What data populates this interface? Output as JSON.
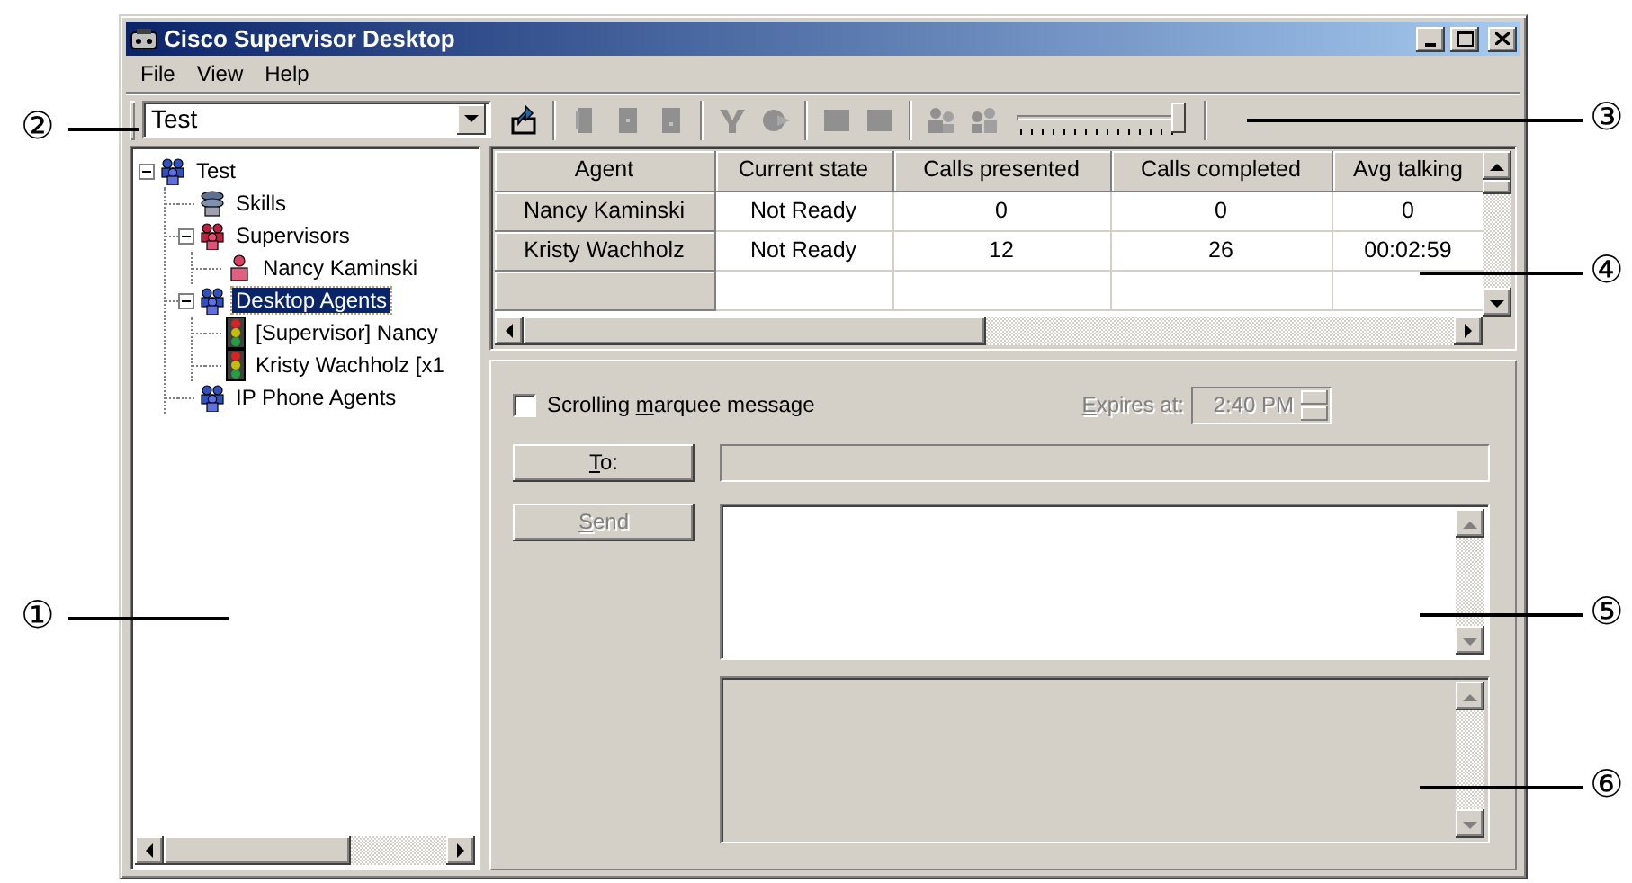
{
  "window": {
    "title": "Cisco Supervisor Desktop"
  },
  "menu": [
    {
      "label": "File"
    },
    {
      "label": "View"
    },
    {
      "label": "Help"
    }
  ],
  "team_select": {
    "value": "Test"
  },
  "toolbar": {
    "slider": {
      "level": 1.0
    }
  },
  "tree": [
    {
      "label": "Test",
      "kind": "agent-group",
      "expanded": true,
      "selected": false,
      "children": [
        {
          "label": "Skills",
          "kind": "skill-group",
          "selected": false
        },
        {
          "label": "Supervisors",
          "kind": "supervisor-group",
          "expanded": true,
          "selected": false,
          "children": [
            {
              "label": "Nancy Kaminski",
              "kind": "supervisor",
              "selected": false
            }
          ]
        },
        {
          "label": "Desktop Agents",
          "kind": "agent-group",
          "expanded": true,
          "selected": true,
          "children": [
            {
              "label": "[Supervisor] Nancy",
              "kind": "agent",
              "selected": false
            },
            {
              "label": "Kristy Wachholz [x1",
              "kind": "agent",
              "selected": false
            }
          ]
        },
        {
          "label": "IP Phone Agents",
          "kind": "agent-group",
          "selected": false
        }
      ]
    }
  ],
  "grid": {
    "columns": [
      "Agent",
      "Current state",
      "Calls presented",
      "Calls completed",
      "Avg talking"
    ],
    "rows": [
      [
        "Nancy Kaminski",
        "Not Ready",
        "0",
        "0",
        "0"
      ],
      [
        "Kristy Wachholz",
        "Not Ready",
        "12",
        "26",
        "00:02:59"
      ]
    ]
  },
  "message": {
    "marquee": {
      "label": {
        "pre": "Scrolling ",
        "key": "m",
        "post": "arquee message"
      },
      "checked": false
    },
    "expires": {
      "label": {
        "key": "E",
        "post": "xpires at:"
      },
      "value": "2:40 PM",
      "disabled": true
    },
    "buttons": [
      {
        "label": {
          "key": "T",
          "post": "o:"
        },
        "disabled": false
      },
      {
        "label": {
          "key": "S",
          "post": "end"
        },
        "disabled": true
      }
    ]
  },
  "callouts": [
    {
      "label": "②"
    },
    {
      "label": "①"
    },
    {
      "label": "③"
    },
    {
      "label": "④"
    },
    {
      "label": "⑤"
    },
    {
      "label": "⑥"
    }
  ]
}
